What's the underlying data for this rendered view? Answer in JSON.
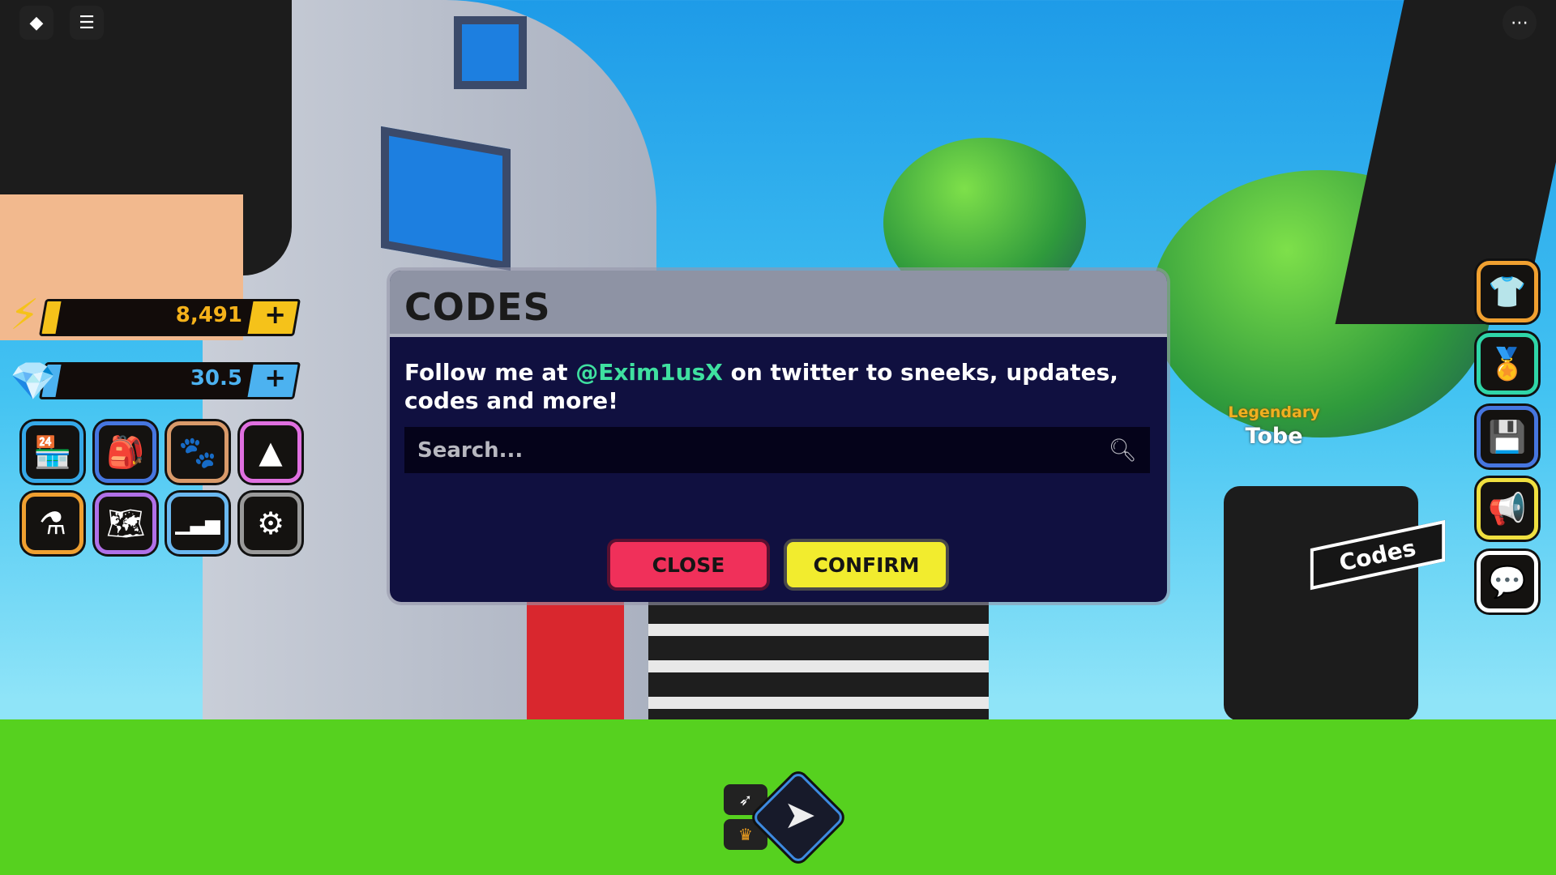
{
  "top_bar": {
    "roblox_icon": "roblox-logo-icon",
    "chat_icon": "chat-notes-icon",
    "menu_icon": "more-options-icon"
  },
  "currency": {
    "energy": {
      "value": "8,491",
      "plus": "+",
      "color": "#f5c21a"
    },
    "gems": {
      "value": "30.5",
      "plus": "+",
      "color": "#4cb2f0"
    }
  },
  "left_menu": [
    {
      "icon": "shop-icon",
      "glyph": "🏪",
      "border": "#35a8e8"
    },
    {
      "icon": "inventory-icon",
      "glyph": "🎒",
      "border": "#4676e0"
    },
    {
      "icon": "pets-paw-icon",
      "glyph": "🐾",
      "border": "#d99a6a"
    },
    {
      "icon": "wizard-hat-icon",
      "glyph": "▲",
      "border": "#e070e0"
    },
    {
      "icon": "potion-icon",
      "glyph": "⚗",
      "border": "#f0a030"
    },
    {
      "icon": "map-icon",
      "glyph": "🗺",
      "border": "#b070e8"
    },
    {
      "icon": "stats-chart-icon",
      "glyph": "▁▃▅",
      "border": "#6ab8f0"
    },
    {
      "icon": "settings-gear-icon",
      "glyph": "⚙",
      "border": "#9a9a9a"
    }
  ],
  "right_menu": [
    {
      "icon": "shirt-icon",
      "glyph": "👕",
      "border": "#f0a030"
    },
    {
      "icon": "award-ribbon-icon",
      "glyph": "🏅",
      "border": "#2fd6a8"
    },
    {
      "icon": "save-floppy-icon",
      "glyph": "💾",
      "border": "#4676e0"
    },
    {
      "icon": "megaphone-icon",
      "glyph": "📢",
      "border": "#f0e040"
    },
    {
      "icon": "chat-bubble-icon",
      "glyph": "💬",
      "border": "#ffffff"
    }
  ],
  "dialog": {
    "title": "CODES",
    "message_pre": "Follow me at ",
    "handle": "@Exim1usX",
    "message_post": " on twitter to sneeks, updates, codes and more!",
    "search_placeholder": "Search...",
    "search_value": "",
    "close_label": "CLOSE",
    "confirm_label": "CONFIRM",
    "close_color": "#f0305a",
    "confirm_color": "#f2ec2e"
  },
  "world": {
    "npc_rarity": "Legendary",
    "npc_name": "Tobe",
    "codes_sign": "Codes"
  }
}
